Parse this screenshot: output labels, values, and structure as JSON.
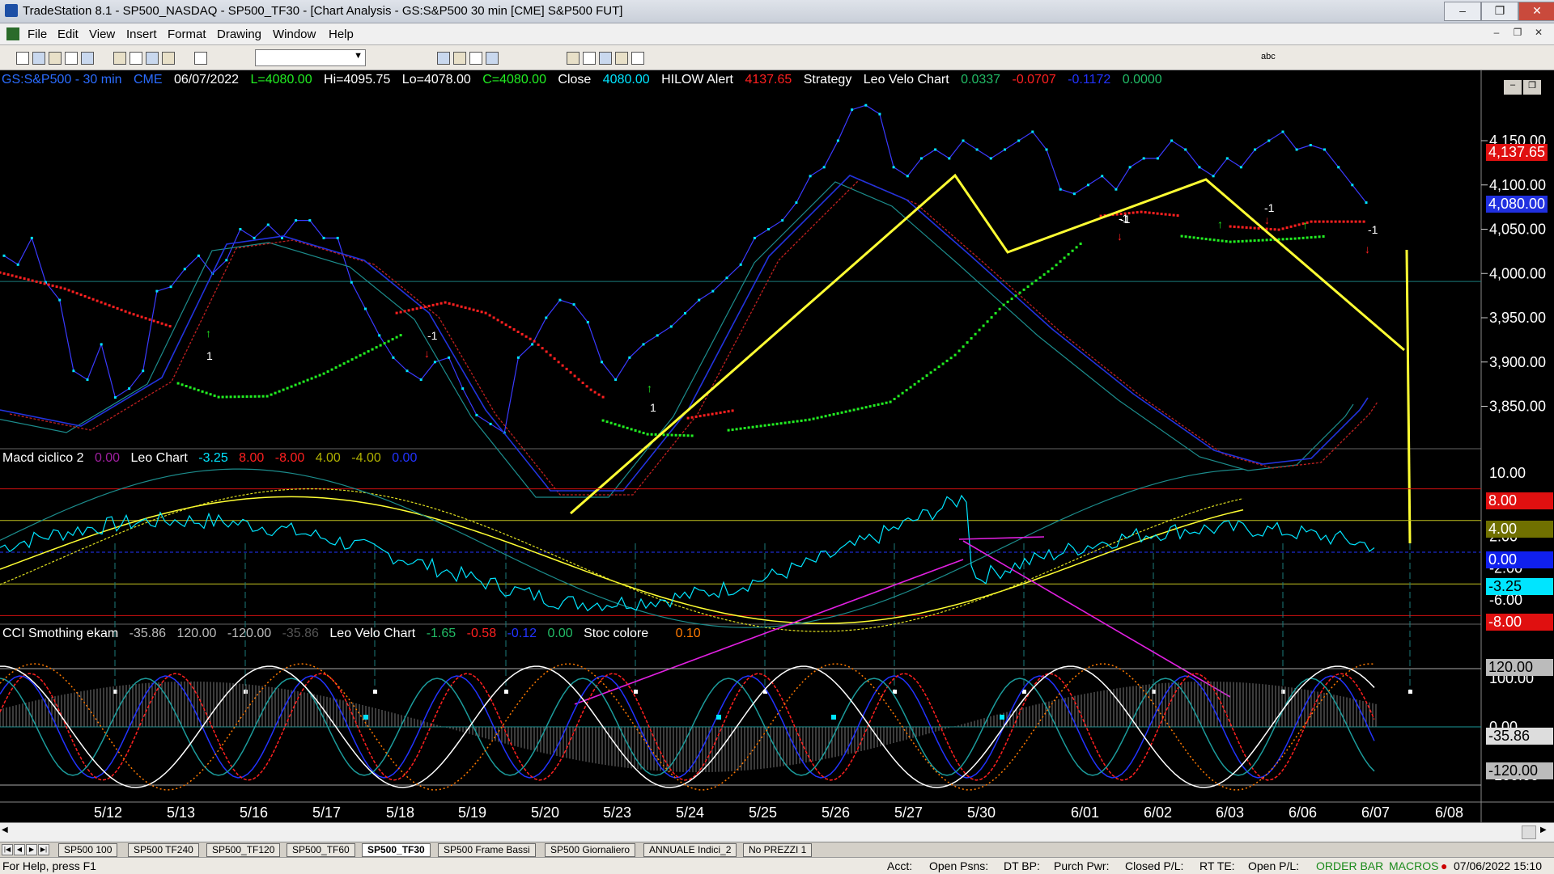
{
  "window": {
    "title": "TradeStation 8.1 - SP500_NASDAQ - SP500_TF30 - [Chart Analysis - GS:S&P500  30 min  [CME] S&P500 FUT]",
    "controls": [
      "–",
      "❐",
      "✕"
    ]
  },
  "menu": {
    "items": [
      "File",
      "Edit",
      "View",
      "Insert",
      "Format",
      "Drawing",
      "Window",
      "Help"
    ],
    "mdi_controls": [
      "–",
      "❐",
      "✕"
    ]
  },
  "toolbar": {
    "icons": [
      "new-icon",
      "open-icon",
      "save-icon",
      "print-icon",
      "cut-icon",
      "copy-icon",
      "paste-icon",
      "chart-icon",
      "zoom-in-icon",
      "zoom-out-icon",
      "cursor-icon",
      "crosshair-icon",
      "trendline-icon",
      "horizontal-line-icon",
      "text-icon",
      "rectangle-icon",
      "ellipse-icon",
      "arrow-up-icon",
      "arrow-down-icon"
    ],
    "abc_label": "abc"
  },
  "chart": {
    "status_line": {
      "symbol": "GS:S&P500 - 30 min",
      "exchange": "CME",
      "date": "06/07/2022",
      "last": "L=4080.00",
      "high": "Hi=4095.75",
      "low": "Lo=4078.00",
      "close": "C=4080.00",
      "close_label": "Close",
      "close_value": "4080.00",
      "hilow_label": "HILOW Alert",
      "hilow_value": "4137.65",
      "strategy_label": "Strategy",
      "leo_label": "Leo Velo Chart",
      "leo_values": [
        "0.0337",
        "-0.0707",
        "-0.1172",
        "0.0000"
      ]
    },
    "price_axis": [
      "4,150.00",
      "4,100.00",
      "4,050.00",
      "4,000.00",
      "3,950.00",
      "3,900.00",
      "3,850.00"
    ],
    "price_boxes": {
      "hilow": "4,137.65",
      "last": "4,080.00"
    },
    "signals": [
      "1",
      "-1",
      "1",
      "-1",
      "-1",
      "-1",
      "-1"
    ],
    "macd_panel": {
      "label": "Macd ciclico 2",
      "v1": "0.00",
      "leo_label": "Leo Chart",
      "leo_values": [
        "-3.25",
        "8.00",
        "-8.00",
        "4.00",
        "-4.00",
        "0.00"
      ],
      "axis": [
        "10.00",
        "6.00",
        "2.00",
        "-2.00",
        "-6.00"
      ],
      "boxes": [
        "8.00",
        "4.00",
        "0.00",
        "-3.25",
        "-8.00"
      ]
    },
    "cci_panel": {
      "label": "CCI Smothing ekam",
      "values": [
        "-35.86",
        "120.00",
        "-120.00",
        "-35.86"
      ],
      "leo_label": "Leo Velo Chart",
      "leo_values": [
        "-1.65",
        "-0.58",
        "-0.12",
        "0.00"
      ],
      "stoc_label": "Stoc colore",
      "stoc_value": "0.10",
      "axis": [
        "100.00",
        "0.00",
        "-100.00"
      ],
      "boxes": [
        "120.00",
        "-35.86",
        "-120.00"
      ]
    },
    "date_axis": [
      "5/12",
      "5/13",
      "5/16",
      "5/17",
      "5/18",
      "5/19",
      "5/20",
      "5/23",
      "5/24",
      "5/25",
      "5/26",
      "5/27",
      "5/30",
      "6/01",
      "6/02",
      "6/03",
      "6/06",
      "6/07",
      "6/08"
    ],
    "colors": {
      "bg": "#000000",
      "price": "#00e5ff",
      "red": "#ff2020",
      "green": "#22ee22",
      "yellow": "#ffff33",
      "magenta": "#e020e0",
      "blue": "#2233ff"
    }
  },
  "sheet_tabs": [
    "SP500 100",
    "SP500 TF240",
    "SP500_TF120",
    "SP500_TF60",
    "SP500_TF30",
    "SP500 Frame Bassi",
    "SP500 Giornaliero",
    "ANNUALE Indici_2",
    "No PREZZI 1"
  ],
  "active_tab": "SP500_TF30",
  "statusbar": {
    "help": "For Help, press F1",
    "acct": "Acct:",
    "open_psns": "Open Psns:",
    "dt_bp": "DT BP:",
    "purch_pwr": "Purch Pwr:",
    "closed_pl": "Closed P/L:",
    "rt_te": "RT TE:",
    "open_pl": "Open P/L:",
    "order_bar": "ORDER BAR",
    "macros": "MACROS",
    "datetime": "07/06/2022 15:10"
  }
}
